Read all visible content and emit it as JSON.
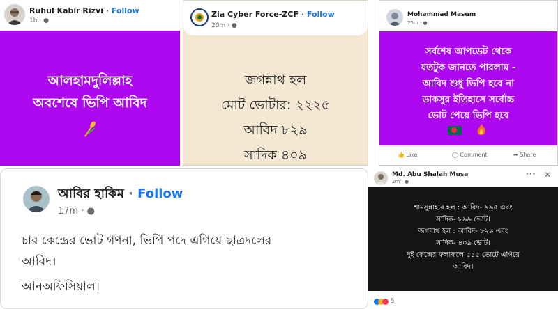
{
  "posts": [
    {
      "author": "Ruhul Kabir Rizvi",
      "follow": "Follow",
      "time": "1h",
      "text": [
        "আলহামদুলিল্লাহ",
        "অবশেষে ভিপি আবিদ"
      ],
      "bg_color": "#ad08f0",
      "decor_icon": "wheat-sheaf-icon"
    },
    {
      "author": "Zia Cyber Force-ZCF",
      "follow": "Follow",
      "time": "20m",
      "text": [
        "জগন্নাথ হল",
        "মোট ভোটার: ২২২৫",
        "আবিদ ৮২৯",
        "সাদিক ৪০৯"
      ],
      "bg_color": "#f4e8d3"
    },
    {
      "author": "Mohammad Masum",
      "time": "25m",
      "text": [
        "সর্বশেষ আপডেট থেকে",
        "যতটুক জানতে পারলাম -",
        "আবিদ শুধু ভিপি হবে না",
        "ডাকসুর ইতিহাসে সর্বোচ্চ",
        "ভোট পেয়ে ভিপি হবে"
      ],
      "emojis": [
        "bangladesh-flag-icon",
        "fire-icon"
      ],
      "actions": [
        "Like",
        "Comment",
        "Share"
      ],
      "bg_color": "#ad08f0"
    },
    {
      "author": "আবির হাকিম",
      "follow": "Follow",
      "time": "17m",
      "text": [
        "চার কেন্দ্রের ভোট গণনা, ভিপি পদে এগিয়ে ছাত্রদলের",
        "আবিদ।",
        "আনঅফিসিয়াল।"
      ]
    },
    {
      "author": "Md. Abu Shalah Musa",
      "time": "2m",
      "text": [
        "শামসুন্নাহার হল : আবিদ- ৯৯৫ এবং",
        "সাদিক- ৮৯৯ ভোট।",
        "জগন্নাথ হল : আবিদ- ৮২৯ এবং",
        "সাদিক- ৪০৯ ভোট।",
        "দুই কেন্দ্রের ফলাফলে ৫১৫ ভোটে এগিয়ে",
        "আবিদ।"
      ],
      "reaction_count": "5",
      "bg_color": "#141414"
    }
  ],
  "ui": {
    "dot": "·",
    "more": "···"
  }
}
